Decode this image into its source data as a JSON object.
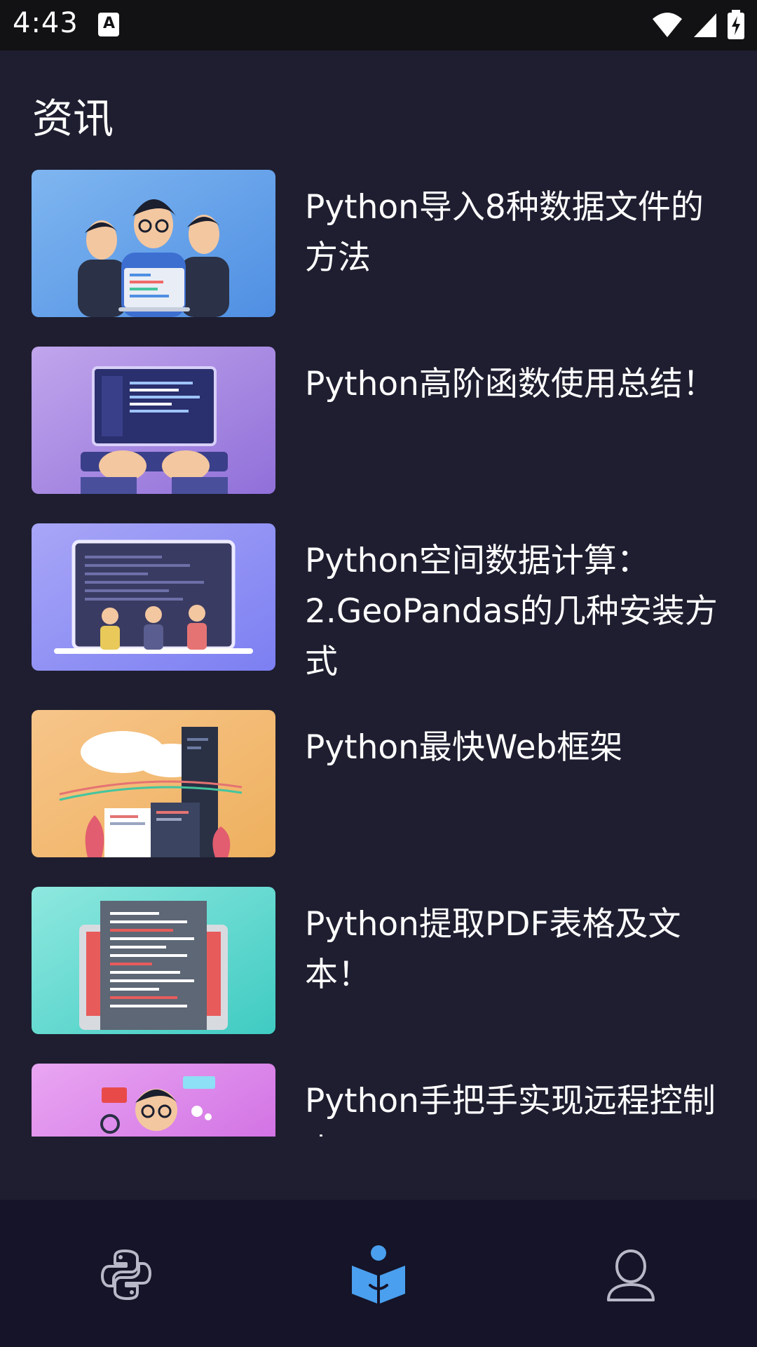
{
  "status_bar": {
    "time": "4:43",
    "icons": [
      "notification-a-icon",
      "wifi-icon",
      "cellular-signal-icon",
      "battery-charging-icon"
    ]
  },
  "page": {
    "title": "资讯"
  },
  "articles": [
    {
      "title": "Python导入8种数据文件的方法",
      "thumbnail": "team-with-laptop-illustration",
      "thumbnail_color": "#5b9ce8"
    },
    {
      "title": "Python高阶函数使用总结！",
      "thumbnail": "laptop-coding-illustration",
      "thumbnail_color": "#a98ce0"
    },
    {
      "title": "Python空间数据计算：2.GeoPandas的几种安装方式",
      "thumbnail": "developers-in-front-of-screen-illustration",
      "thumbnail_color": "#8b8ff5"
    },
    {
      "title": "Python最快Web框架",
      "thumbnail": "web-development-illustration",
      "thumbnail_color": "#f3bb7a"
    },
    {
      "title": "Python提取PDF表格及文本！",
      "thumbnail": "code-document-illustration",
      "thumbnail_color": "#5fd8cf"
    },
    {
      "title": "Python手把手实现远程控制桌",
      "thumbnail": "developer-with-tools-illustration",
      "thumbnail_color": "#d77ae6"
    }
  ],
  "bottom_nav": {
    "tabs": [
      {
        "icon": "python-logo-icon",
        "active": false
      },
      {
        "icon": "reading-book-icon",
        "active": true
      },
      {
        "icon": "user-profile-icon",
        "active": false
      }
    ],
    "active_color": "#4a9fee",
    "inactive_color": "#b8b8c8"
  }
}
